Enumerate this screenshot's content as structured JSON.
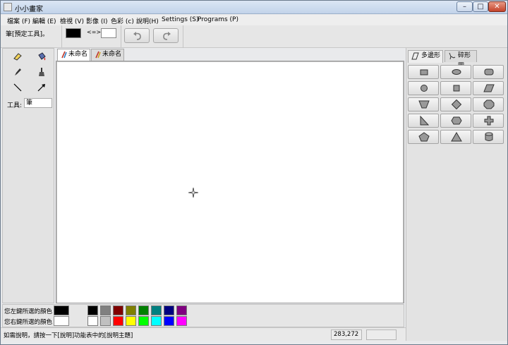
{
  "window": {
    "title": "小小畫家"
  },
  "menu": [
    "檔案 (F)",
    "編輯 (E)",
    "檢視 (V)",
    "影像 (I)",
    "色彩 (c)",
    "說明(H)",
    "Settings (S)",
    "Programs (P)"
  ],
  "toolbar": {
    "tool_status": "筆[預定工具]。",
    "swap_label": "<=>"
  },
  "tools": {
    "label": "工具:",
    "current": "筆",
    "items": [
      "eraser-icon",
      "fill-bucket-icon",
      "pencil-icon",
      "brush-icon",
      "line-icon",
      "arrow-icon"
    ]
  },
  "tabs": [
    {
      "label": "未命名1"
    },
    {
      "label": "未命名2"
    }
  ],
  "right_tabs": [
    {
      "label": "多邊形"
    },
    {
      "label": "碎形圖"
    }
  ],
  "shapes": [
    "rectangle-icon",
    "ellipse-icon",
    "rounded-rectangle-icon",
    "circle-icon",
    "square-icon",
    "parallelogram-icon",
    "trapezoid-icon",
    "diamond-icon",
    "octagon-icon",
    "right-triangle-icon",
    "hexagon-icon",
    "cross-icon",
    "pentagon-icon",
    "triangle-icon",
    "cylinder-icon"
  ],
  "palette": {
    "left_label": "您左鍵所選的顏色",
    "right_label": "您右鍵所選的顏色",
    "left_color": "#000000",
    "right_color": "#ffffff",
    "row1": [
      "#000000",
      "#808080",
      "#800000",
      "#808000",
      "#008000",
      "#008080",
      "#000080",
      "#800080"
    ],
    "row2": [
      "#ffffff",
      "#c0c0c0",
      "#ff0000",
      "#ffff00",
      "#00ff00",
      "#00ffff",
      "#0000ff",
      "#ff00ff"
    ]
  },
  "status": {
    "message": "如需說明，請按一下[說明]功能表中的[說明主題]",
    "coords": "283,272"
  }
}
